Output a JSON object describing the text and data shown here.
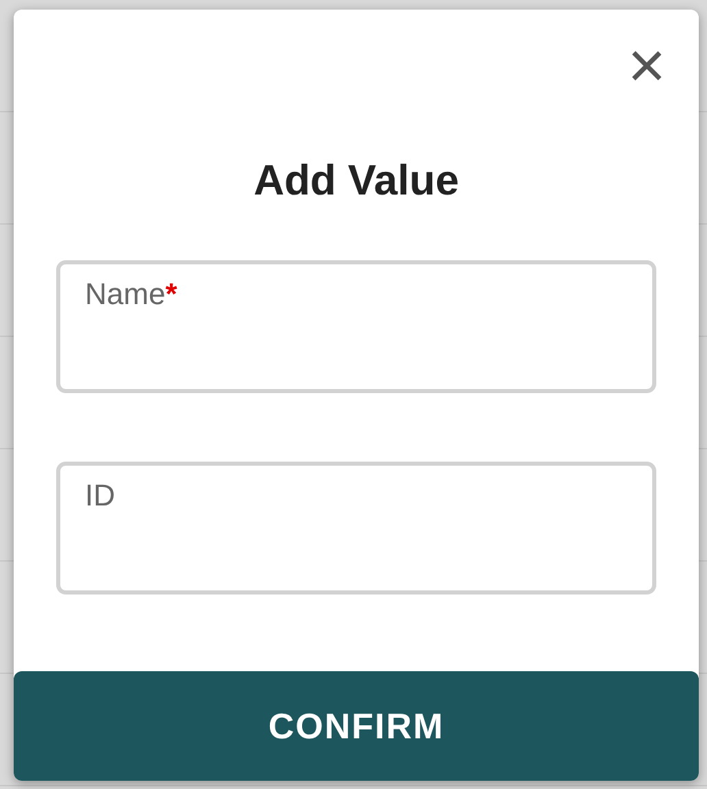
{
  "dialog": {
    "title": "Add Value",
    "close": "×",
    "fields": [
      {
        "label": "Name",
        "required_mark": "*"
      },
      {
        "label": "ID"
      }
    ],
    "confirm": "CONFIRM"
  }
}
